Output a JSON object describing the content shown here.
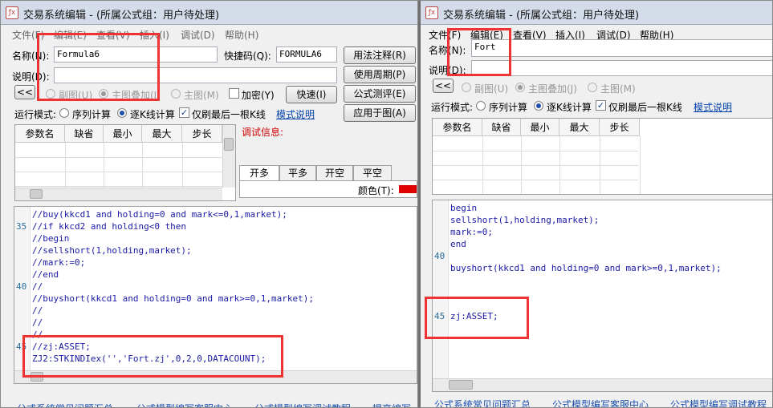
{
  "left": {
    "title": "交易系统编辑 - (所属公式组：用户待处理)",
    "menu": [
      "文件(F)",
      "编辑(E)",
      "查看(V)",
      "插入(I)",
      "调试(D)",
      "帮助(H)"
    ],
    "name_label": "名称(N):",
    "name_value": "Formula6",
    "shortcut_label": "快捷码(Q):",
    "shortcut_value": "FORMULA6",
    "desc_label": "说明(D):",
    "desc_value": "",
    "nav_label": "<<",
    "radio_sub": "副图(U)",
    "radio_main_overlay": "主图叠加(J)",
    "radio_main": "主图(M)",
    "encrypt": "加密(Y)",
    "mode_label": "运行模式:",
    "mode_seq": "序列计算",
    "mode_bar": "逐K线计算",
    "last_bar": "仅刷最后一根K线",
    "mode_link": "模式说明",
    "buttons": [
      "用法注释(R)",
      "使用周期(P)",
      "公式测评(E)",
      "应用于图(A)"
    ],
    "quick_button": "快速(I)",
    "param_headers": [
      "参数名",
      "缺省",
      "最小",
      "最大",
      "步长"
    ],
    "debug_label": "调试信息:",
    "tabs": [
      "开多",
      "平多",
      "开空",
      "平空"
    ],
    "color_label": "颜色(T):",
    "line_numbers": [
      "35",
      "40",
      "45"
    ],
    "code": [
      "//buy(kkcd1 and holding=0 and mark<=0,1,market);",
      "//if kkcd2 and holding<0 then",
      "//begin",
      "//sellshort(1,holding,market);",
      "//mark:=0;",
      "//end",
      "//",
      "//buyshort(kkcd1 and holding=0 and mark>=0,1,market);",
      "//",
      "//",
      "//",
      "//zj:ASSET;",
      "ZJ2:STKINDIex('','Fort.zj',0,2,0,DATACOUNT);"
    ],
    "status_links": [
      "公式系统常见问题汇总",
      "公式模型编写客服中心",
      "公式模型编写调试教程",
      "提高编写"
    ]
  },
  "right": {
    "title": "交易系统编辑 - (所属公式组：用户待处理)",
    "menu": [
      "文件(F)",
      "编辑(E)",
      "查看(V)",
      "插入(I)",
      "调试(D)",
      "帮助(H)"
    ],
    "name_label": "名称(N):",
    "name_value": "Fort",
    "desc_label": "说明(D):",
    "nav_label": "<<",
    "radio_sub": "副图(U)",
    "radio_main_overlay": "主图叠加(J)",
    "radio_main": "主图(M)",
    "mode_label": "运行模式:",
    "mode_seq": "序列计算",
    "mode_bar": "逐K线计算",
    "last_bar": "仅刷最后一根K线",
    "mode_link": "模式说明",
    "param_headers": [
      "参数名",
      "缺省",
      "最小",
      "最大",
      "步长"
    ],
    "line_numbers": [
      "40",
      "45"
    ],
    "code": [
      "begin",
      "sellshort(1,holding,market);",
      "mark:=0;",
      "end",
      "",
      "buyshort(kkcd1 and holding=0 and mark>=0,1,market);",
      "",
      "",
      "",
      "zj:ASSET;"
    ],
    "status_links": [
      "公式系统常见问题汇总",
      "公式模型编写客服中心",
      "公式模型编写调试教程"
    ]
  },
  "colors": {
    "highlight_box": "#ee3333",
    "link": "#0645ad",
    "color_swatch": "#e00000"
  }
}
